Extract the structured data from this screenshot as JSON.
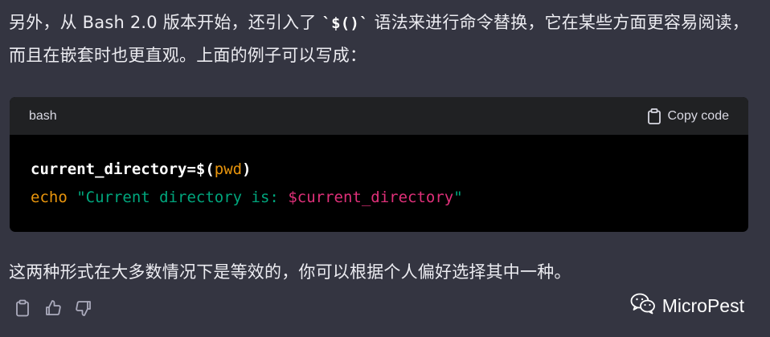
{
  "message": {
    "para1_before": "另外，从 Bash 2.0 版本开始，还引入了 ",
    "para1_code": "`$()`",
    "para1_after": " 语法来进行命令替换，它在某些方面更容易阅读，而且在嵌套时也更直观。上面的例子可以写成：",
    "para2": "这两种形式在大多数情况下是等效的，你可以根据个人偏好选择其中一种。"
  },
  "code_block": {
    "language": "bash",
    "copy_label": "Copy code",
    "line1": {
      "assign": "current_directory=$(",
      "cmd": "pwd",
      "close": ")"
    },
    "line2": {
      "builtin": "echo",
      "string": "\"Current directory is: ",
      "var": "$current_directory",
      "string_end": "\""
    }
  },
  "actions": {
    "icons": [
      "clipboard-icon",
      "thumbs-up-icon",
      "thumbs-down-icon"
    ]
  },
  "watermark": {
    "text": "MicroPest",
    "icon": "wechat-icon"
  },
  "colors": {
    "background": "#343541",
    "code_header": "#202123",
    "code_body": "#000000",
    "builtin": "#e9950c",
    "string": "#00a67d",
    "variable": "#df3079"
  }
}
